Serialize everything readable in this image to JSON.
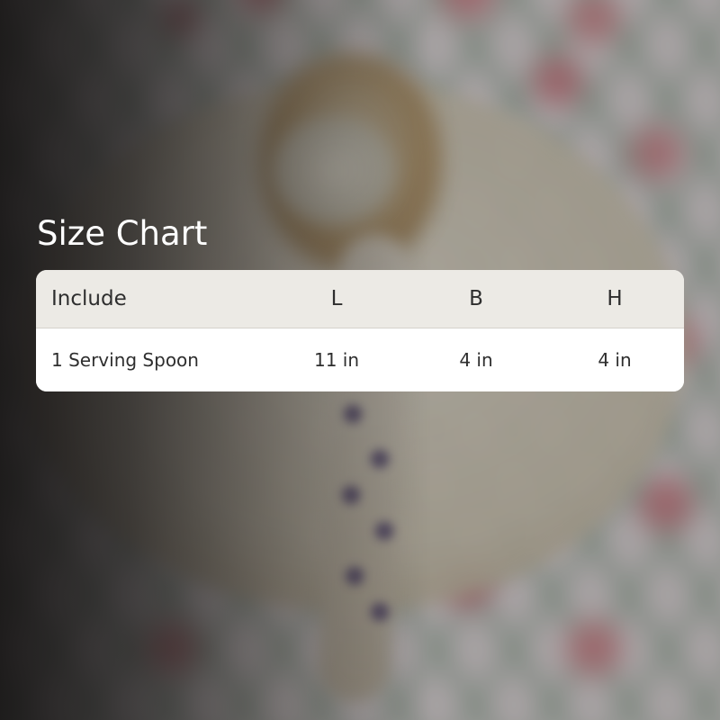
{
  "size_chart": {
    "title": "Size Chart",
    "columns": {
      "include": "Include",
      "l": "L",
      "b": "B",
      "h": "H"
    },
    "rows": [
      {
        "include": "1 Serving Spoon",
        "l": "11 in",
        "b": "4 in",
        "h": "4 in"
      }
    ]
  },
  "colors": {
    "title_text": "#ffffff",
    "table_header_bg": "#eceae5",
    "table_body_bg": "#ffffff",
    "table_text": "#2e2e2e"
  }
}
